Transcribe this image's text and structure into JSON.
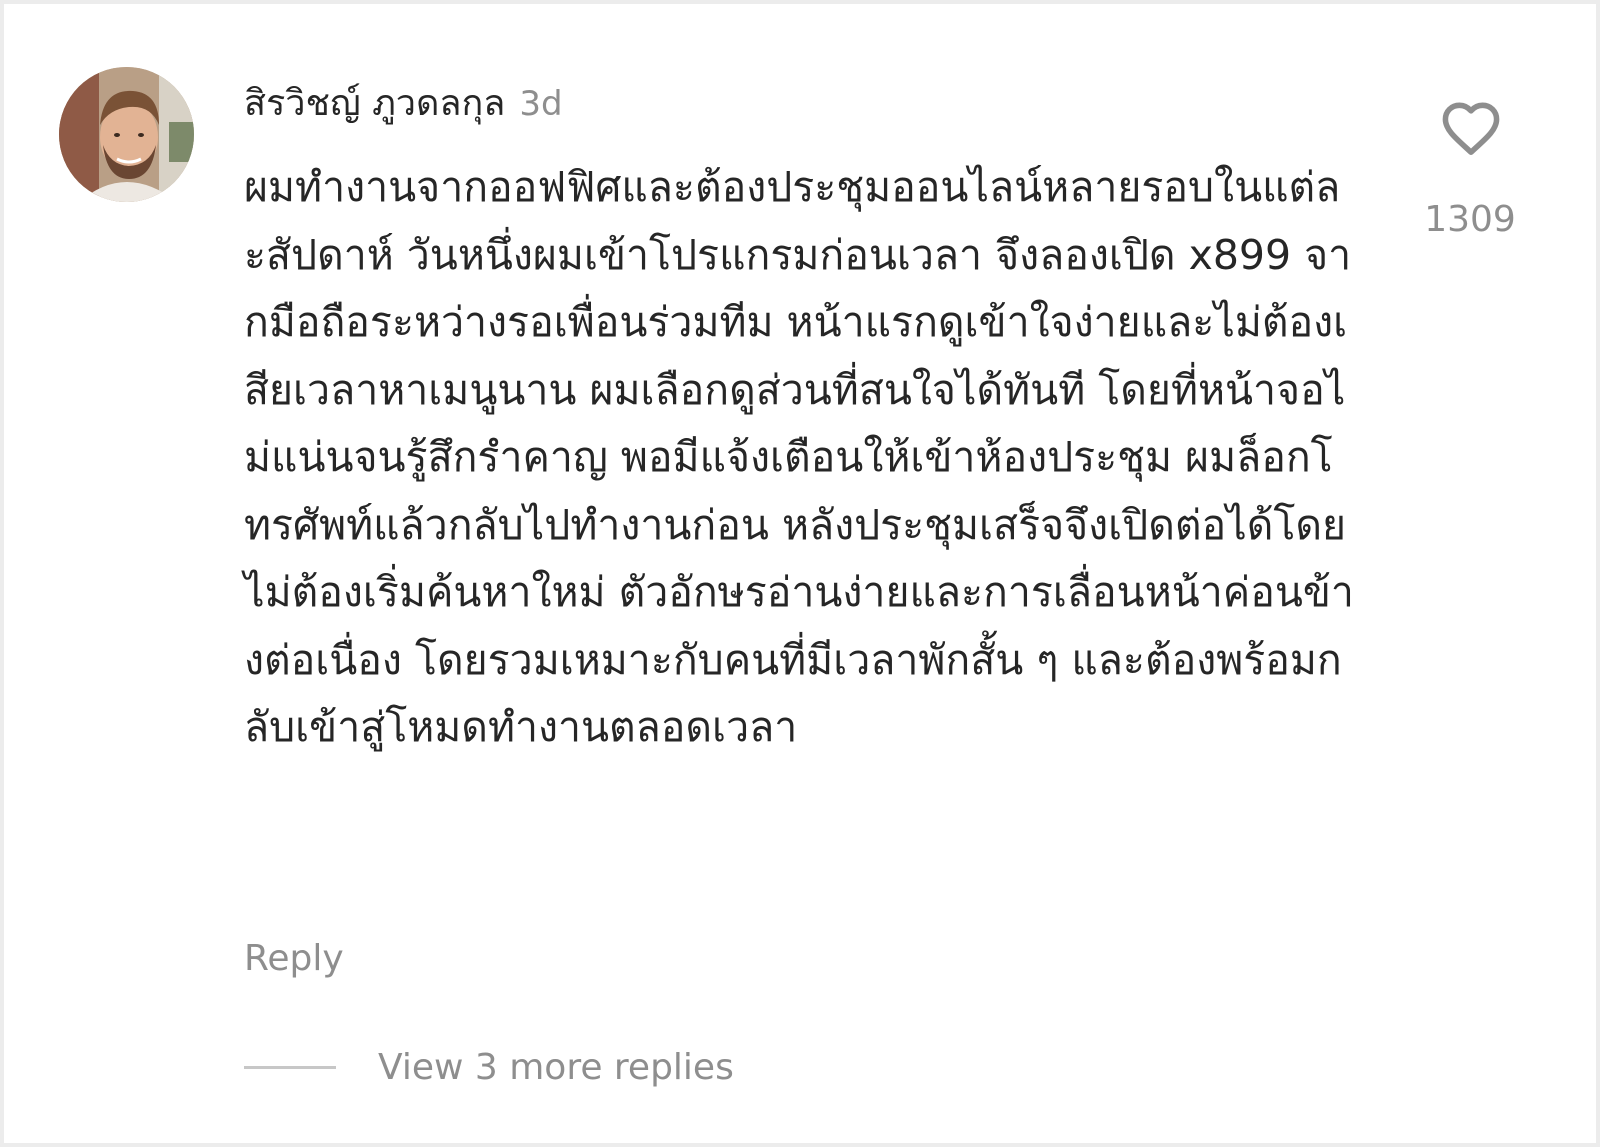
{
  "comment": {
    "author": "สิรวิชญ์ ภูวดลกุล",
    "time": "3d",
    "text": "ผมทำงานจากออฟฟิศและต้องประชุมออนไลน์หลายรอบในแต่ละสัปดาห์ วันหนึ่งผมเข้าโปรแกรมก่อนเวลา จึงลองเปิด x899 จากมือถือระหว่างรอเพื่อนร่วมทีม หน้าแรกดูเข้าใจง่ายและไม่ต้องเสียเวลาหาเมนูนาน ผมเลือกดูส่วนที่สนใจได้ทันที โดยที่หน้าจอไม่แน่นจนรู้สึกรำคาญ พอมีแจ้งเตือนให้เข้าห้องประชุม ผมล็อกโทรศัพท์แล้วกลับไปทำงานก่อน หลังประชุมเสร็จจึงเปิดต่อได้โดยไม่ต้องเริ่มค้นหาใหม่ ตัวอักษรอ่านง่ายและการเลื่อนหน้าค่อนข้างต่อเนื่อง โดยรวมเหมาะกับคนที่มีเวลาพักสั้น ๆ และต้องพร้อมกลับเข้าสู่โหมดทำงานตลอดเวลา",
    "reply_label": "Reply",
    "like_count": "1309",
    "like_icon": "heart-outline-icon",
    "view_replies_label": "View 3 more replies"
  }
}
